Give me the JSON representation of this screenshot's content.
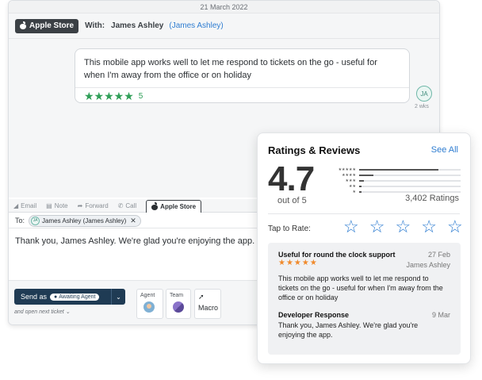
{
  "ticket": {
    "date": "21 March 2022",
    "store_label": "Apple Store",
    "with_label": "With:",
    "with_name": "James Ashley",
    "with_paren": "(James Ashley)",
    "message": {
      "text": "This mobile app works well to let me respond to tickets on the go - useful for when I'm away from the office or on holiday",
      "stars": "★★★★★",
      "rating": "5",
      "avatar_initials": "JA",
      "time_ago": "2 wks"
    },
    "compose": {
      "tabs": [
        {
          "icon": "◢",
          "label": "Email"
        },
        {
          "icon": "▤",
          "label": "Note"
        },
        {
          "icon": "➦",
          "label": "Forward"
        },
        {
          "icon": "✆",
          "label": "Call"
        },
        {
          "label": "Apple Store"
        }
      ],
      "to_label": "To:",
      "to_chip": "James Ashley (James Ashley)",
      "to_chip_initials": "JA",
      "reply_text": "Thank you, James Ashley. We're glad you're enjoying the app."
    },
    "footer": {
      "send_as": "Send as",
      "send_status": "Awaiting Agent",
      "next_ticket": "and open next ticket ⌄",
      "agent_label": "Agent",
      "team_label": "Team",
      "macro_label": "Macro"
    }
  },
  "ratings": {
    "title": "Ratings & Reviews",
    "see_all": "See All",
    "score": "4.7",
    "out_of": "out of 5",
    "count": "3,402 Ratings",
    "distribution": [
      {
        "stars": "★★★★★",
        "fraction": 0.78
      },
      {
        "stars": "★★★★",
        "fraction": 0.14
      },
      {
        "stars": "★★★",
        "fraction": 0.05
      },
      {
        "stars": "★★",
        "fraction": 0.02
      },
      {
        "stars": "★",
        "fraction": 0.02
      }
    ],
    "tap_label": "Tap to Rate:",
    "tap_stars": [
      "☆",
      "☆",
      "☆",
      "☆",
      "☆"
    ],
    "review": {
      "title": "Useful for round the clock support",
      "date": "27 Feb",
      "stars": "★★★★★",
      "author": "James Ashley",
      "body": "This mobile app works well to let me respond to tickets on the go - useful for when I'm away from the office or on holiday"
    },
    "dev_response": {
      "title": "Developer Response",
      "date": "9 Mar",
      "body": "Thank you, James Ashley. We're glad you're enjoying the app."
    }
  }
}
